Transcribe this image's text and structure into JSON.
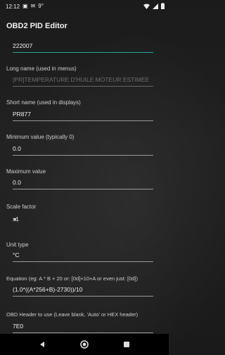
{
  "status": {
    "time": "12:12",
    "extra": "9°"
  },
  "app": {
    "title": "OBD2 PID Editor"
  },
  "fields": {
    "pid": "222007",
    "long_name_label": "Long name (used in menus)",
    "long_name_value": "[PR]TEMPERATURE D'HUILE MOTEUR ESTIMEE",
    "short_name_label": "Short name (used in displays)",
    "short_name_value": "PR877",
    "min_label": "Minimum value (typically 0)",
    "min_value": "0.0",
    "max_label": "Maximum value",
    "max_value": "0.0",
    "scale_label": "Scale factor",
    "scale_value": "x1",
    "unit_label": "Unit type",
    "unit_value": "°C",
    "equation_label": "Equation (eg:  A * B + 20   or: [0d]+10+A  or even just: [0d])",
    "equation_value": "(1.0*((A*256+B)-2730))/10",
    "header_label": "OBD Header to use (Leave blank, 'Auto' or HEX header)",
    "header_value": "7E0"
  },
  "colors": {
    "accent": "#26a69a",
    "navbar": "#000000"
  },
  "icons": [
    "notification-icon",
    "message-icon",
    "wifi-icon",
    "signal-icon",
    "battery-icon",
    "dropdown-arrow-icon",
    "back-icon",
    "home-icon",
    "recents-icon"
  ]
}
